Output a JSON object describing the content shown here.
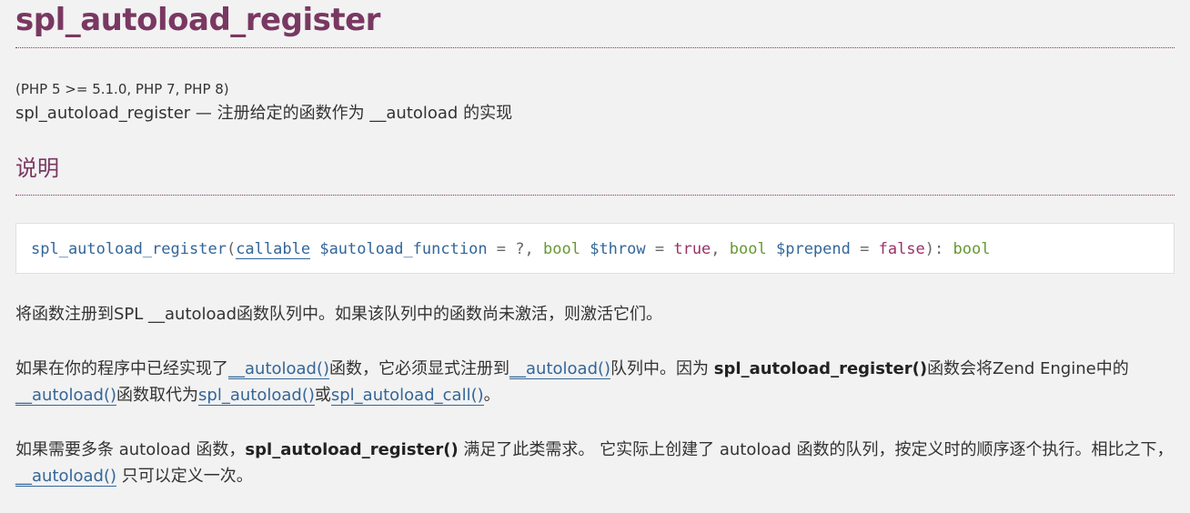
{
  "title": "spl_autoload_register",
  "version": "(PHP 5 >= 5.1.0, PHP 7, PHP 8)",
  "refname": "spl_autoload_register",
  "dash": " — ",
  "purpose": "注册给定的函数作为 __autoload 的实现",
  "section_heading": "说明",
  "synopsis": {
    "function_name": "spl_autoload_register",
    "open_paren": "(",
    "param1_type": "callable",
    "param1_name": "$autoload_function",
    "param1_default": " = ?",
    "param2_type": "bool",
    "param2_name": "$throw",
    "param2_default": "true",
    "param3_type": "bool",
    "param3_name": "$prepend",
    "param3_default": "false",
    "close_paren": "): ",
    "return_type": "bool",
    "comma": ", ",
    "equals": " = "
  },
  "para1": "将函数注册到SPL __autoload函数队列中。如果该队列中的函数尚未激活，则激活它们。",
  "para2": {
    "t1": "如果在你的程序中已经实现了",
    "link1": "__autoload()",
    "t2": "函数，它必须显式注册到",
    "link2": "__autoload()",
    "t3": "队列中。因为 ",
    "bold1": "spl_autoload_register()",
    "t4": "函数会将Zend Engine中的",
    "link3": "__autoload()",
    "t5": "函数取代为",
    "link4": "spl_autoload()",
    "t6": "或",
    "link5": "spl_autoload_call()",
    "t7": "。"
  },
  "para3": {
    "t1": "如果需要多条 autoload 函数，",
    "bold1": "spl_autoload_register()",
    "t2": " 满足了此类需求。 它实际上创建了 autoload 函数的队列，按定义时的顺序逐个执行。相比之下， ",
    "link1": "__autoload()",
    "t3": " 只可以定义一次。"
  }
}
